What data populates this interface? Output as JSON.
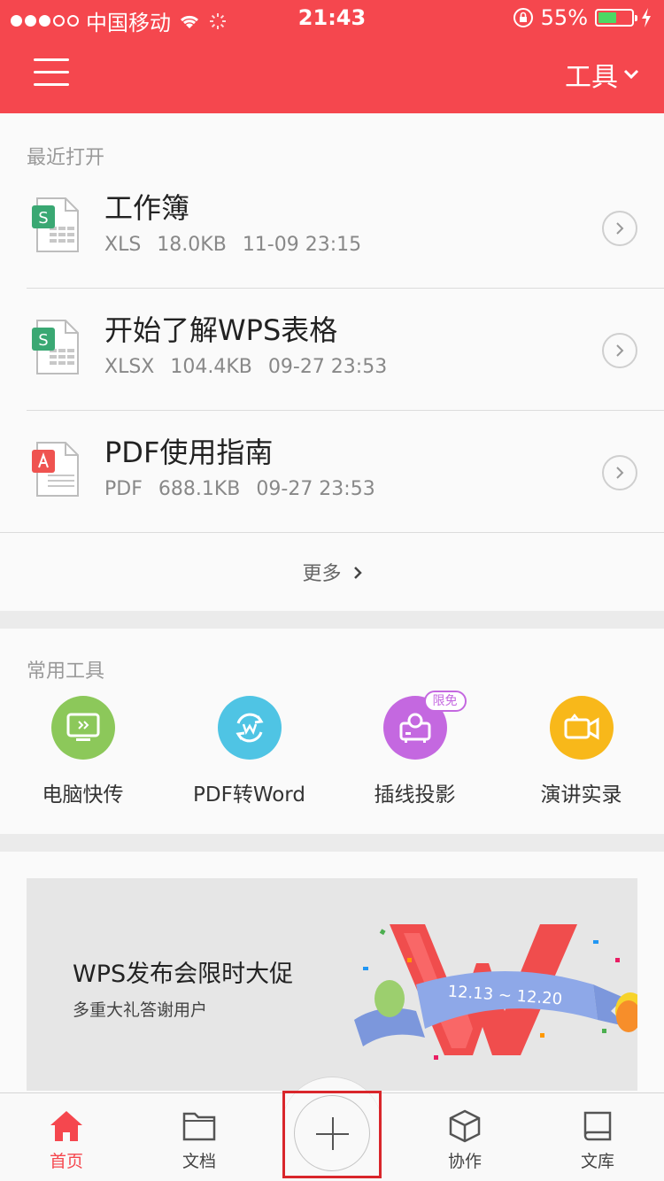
{
  "status_bar": {
    "carrier": "中国移动",
    "time": "21:43",
    "battery": "55%",
    "battery_level": 0.55
  },
  "header": {
    "tools_label": "工具"
  },
  "recent": {
    "title": "最近打开",
    "files": [
      {
        "name": "工作簿",
        "type": "XLS",
        "size": "18.0KB",
        "time": "11-09 23:15",
        "icon": "spreadsheet-icon"
      },
      {
        "name": "开始了解WPS表格",
        "type": "XLSX",
        "size": "104.4KB",
        "time": "09-27 23:53",
        "icon": "spreadsheet-icon"
      },
      {
        "name": "PDF使用指南",
        "type": "PDF",
        "size": "688.1KB",
        "time": "09-27 23:53",
        "icon": "pdf-icon"
      }
    ],
    "more_label": "更多"
  },
  "tools": {
    "title": "常用工具",
    "items": [
      {
        "label": "电脑快传",
        "icon": "pc-transfer-icon",
        "color": "#8cc85a"
      },
      {
        "label": "PDF转Word",
        "icon": "pdf-to-word-icon",
        "color": "#4fc4e4"
      },
      {
        "label": "插线投影",
        "icon": "projector-icon",
        "color": "#c468e0",
        "badge": "限免"
      },
      {
        "label": "演讲实录",
        "icon": "video-record-icon",
        "color": "#f8b81a"
      }
    ]
  },
  "banner": {
    "title": "WPS发布会限时大促",
    "subtitle": "多重大礼答谢用户",
    "date_range": "12.13 ~ 12.20"
  },
  "tabbar": {
    "tabs": [
      {
        "label": "首页",
        "icon": "home-icon",
        "active": true
      },
      {
        "label": "文档",
        "icon": "folder-icon",
        "active": false
      },
      {
        "label": "协作",
        "icon": "cube-icon",
        "active": false
      },
      {
        "label": "文库",
        "icon": "book-icon",
        "active": false
      }
    ]
  },
  "colors": {
    "brand_red": "#f5474e",
    "spreadsheet_green": "#3aa873",
    "pdf_red": "#ef5350"
  }
}
